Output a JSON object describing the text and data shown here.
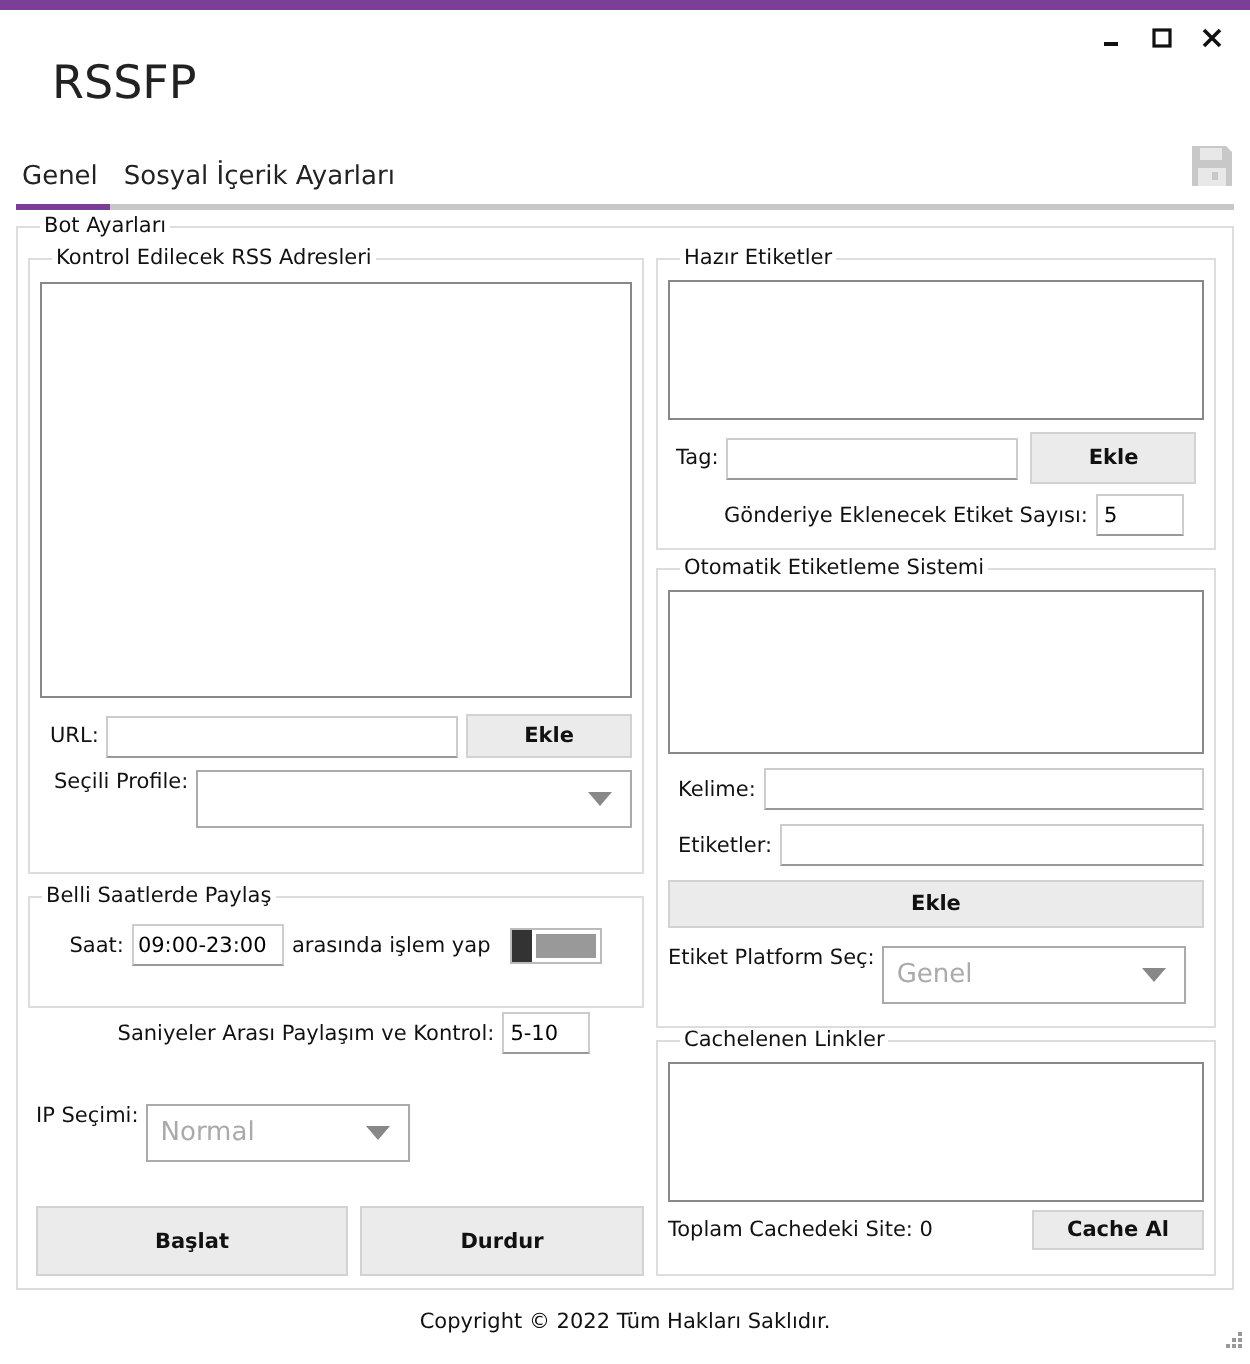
{
  "window": {
    "title": "RSSFP"
  },
  "tabs": [
    {
      "label": "Genel",
      "selected": true
    },
    {
      "label": "Sosyal İçerik Ayarları",
      "selected": false
    }
  ],
  "bot_settings": {
    "title": "Bot Ayarları",
    "rss": {
      "title": "Kontrol Edilecek RSS Adresleri",
      "url_label": "URL:",
      "add_button": "Ekle",
      "profile_label": "Seçili Profile:"
    },
    "schedule": {
      "title": "Belli Saatlerde Paylaş",
      "time_label": "Saat:",
      "time_value": "09:00-23:00",
      "suffix": "arasında işlem yap",
      "on": false
    },
    "interval": {
      "label": "Saniyeler Arası Paylaşım ve Kontrol:",
      "value": "5-10"
    },
    "ip": {
      "label": "IP Seçimi:",
      "value": "Normal",
      "disabled": true
    },
    "buttons": [
      "Başlat",
      "Durdur"
    ],
    "ready_tags": {
      "title": "Hazır Etiketler",
      "tag_label": "Tag:",
      "add_button": "Ekle",
      "count_label": "Gönderiye Eklenecek Etiket Sayısı:",
      "count_value": "5"
    },
    "auto_tagging": {
      "title": "Otomatik Etiketleme Sistemi",
      "word_label": "Kelime:",
      "tags_label": "Etiketler:",
      "add_button": "Ekle",
      "platform_label": "Etiket Platform Seç:",
      "platform_value": "Genel",
      "disabled": true
    },
    "cache": {
      "title": "Cachelenen Linkler",
      "total": "Toplam Cachedeki Site: 0",
      "button": "Cache Al"
    }
  },
  "footer": "Copyright © 2022 Tüm Hakları Saklıdır."
}
